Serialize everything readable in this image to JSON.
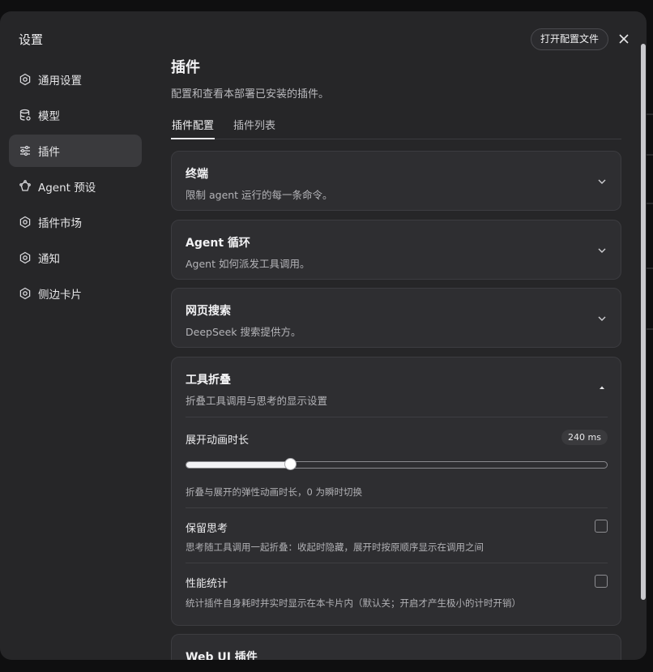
{
  "modal": {
    "title": "设置",
    "open_config_label": "打开配置文件"
  },
  "sidebar": {
    "items": [
      {
        "label": "通用设置",
        "icon": "gear-icon",
        "active": false
      },
      {
        "label": "模型",
        "icon": "database-icon",
        "active": false
      },
      {
        "label": "插件",
        "icon": "sliders-icon",
        "active": true
      },
      {
        "label": "Agent 预设",
        "icon": "agent-icon",
        "active": false
      },
      {
        "label": "插件市场",
        "icon": "gear-icon",
        "active": false
      },
      {
        "label": "通知",
        "icon": "gear-icon",
        "active": false
      },
      {
        "label": "侧边卡片",
        "icon": "gear-icon",
        "active": false
      }
    ]
  },
  "main": {
    "title": "插件",
    "description": "配置和查看本部署已安装的插件。",
    "tabs": [
      {
        "label": "插件配置",
        "active": true
      },
      {
        "label": "插件列表",
        "active": false
      }
    ],
    "cards": [
      {
        "title": "终端",
        "desc": "限制 agent 运行的每一条命令。",
        "expanded": false
      },
      {
        "title": "Agent 循环",
        "desc": "Agent 如何派发工具调用。",
        "expanded": false
      },
      {
        "title": "网页搜索",
        "desc": "DeepSeek 搜索提供方。",
        "expanded": false
      },
      {
        "title": "工具折叠",
        "desc": "折叠工具调用与思考的显示设置",
        "expanded": true
      }
    ],
    "tool_fold": {
      "anim": {
        "label": "展开动画时长",
        "value_text": "240 ms",
        "fraction": 0.248,
        "help": "折叠与展开的弹性动画时长，0 为瞬时切换"
      },
      "keep_thinking": {
        "label": "保留思考",
        "help": "思考随工具调用一起折叠：收起时隐藏，展开时按原顺序显示在调用之间",
        "checked": false
      },
      "perf_stats": {
        "label": "性能统计",
        "help": "统计插件自身耗时并实时显示在本卡片内（默认关；开启才产生极小的计时开销）",
        "checked": false
      }
    },
    "next_card_title": "Web UI 插件"
  },
  "colors": {
    "modal_bg": "#262628",
    "card_bg": "#2e2e31",
    "active_nav": "#3a3a3d"
  }
}
